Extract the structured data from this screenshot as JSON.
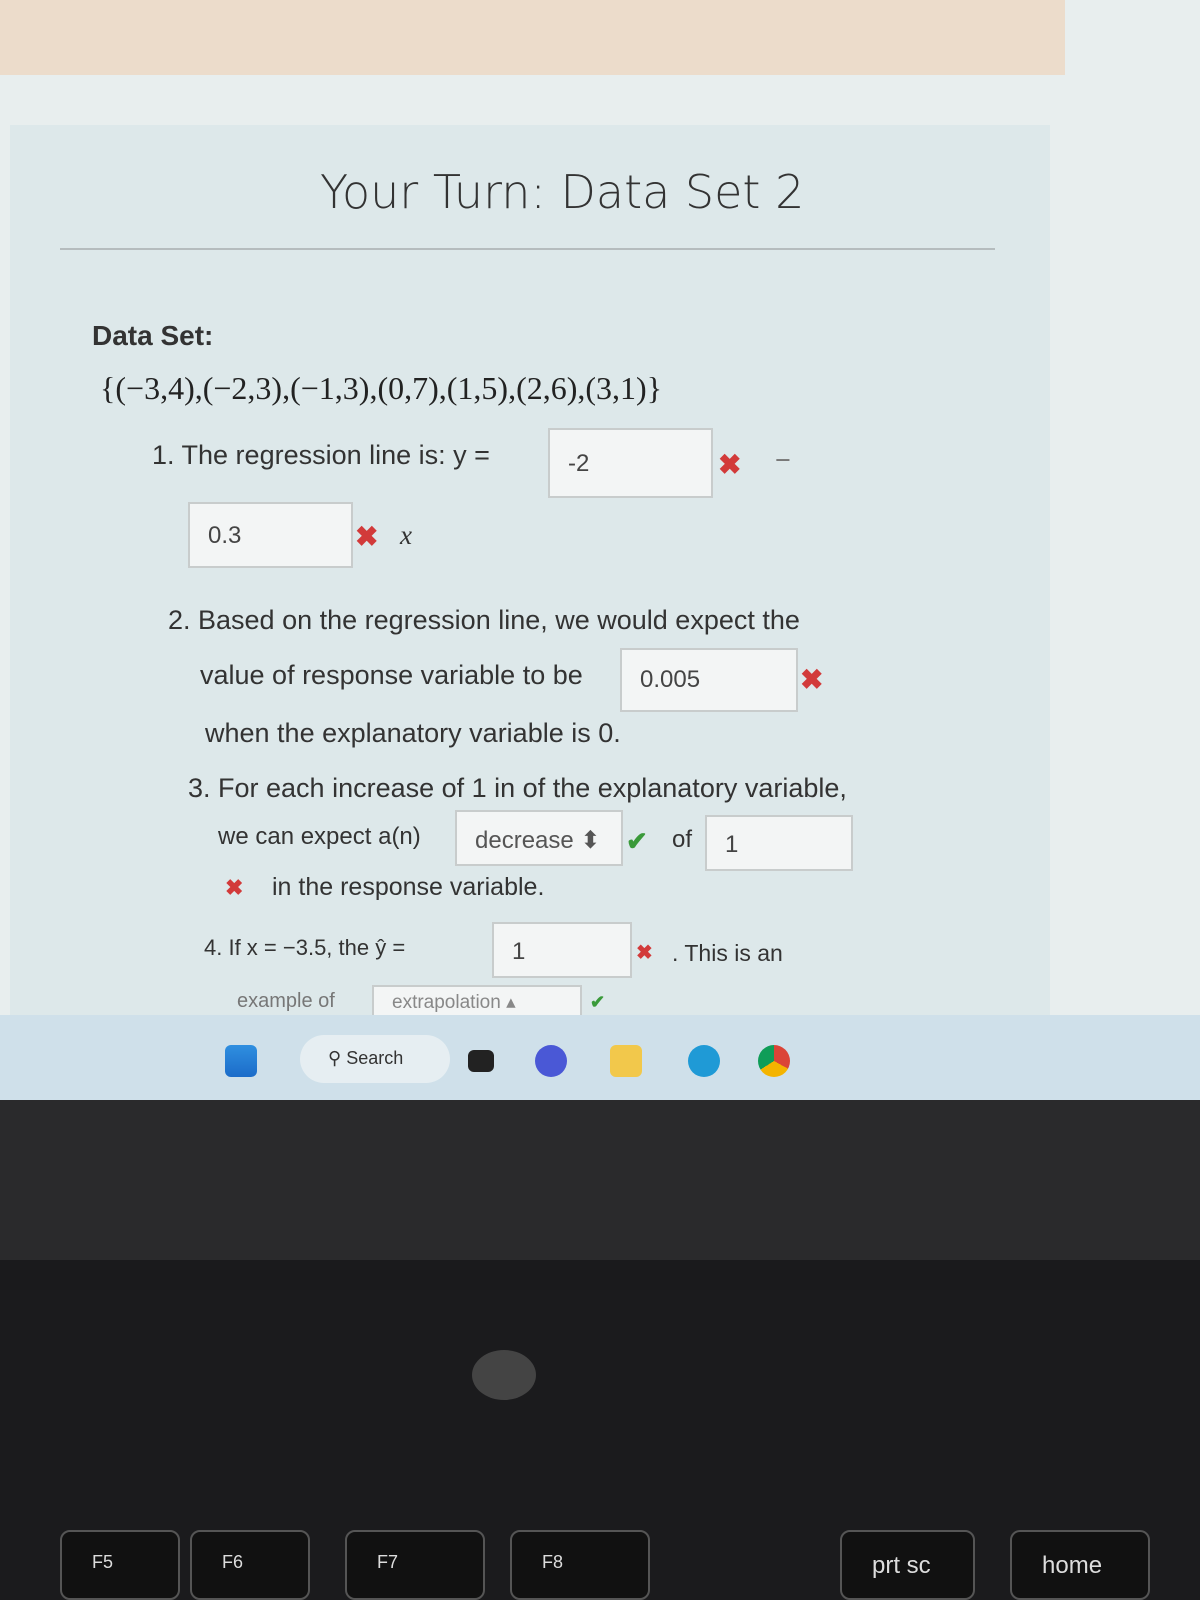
{
  "page": {
    "title": "Your Turn: Data Set 2",
    "data_set_label": "Data Set:",
    "data_set": "{(−3,4),(−2,3),(−1,3),(0,7),(1,5),(2,6),(3,1)}"
  },
  "q1": {
    "prefix": "1. The regression line is: y =",
    "intercept_value": "-2",
    "intercept_status": "incorrect",
    "minus": "−",
    "slope_value": "0.3",
    "slope_status": "incorrect",
    "x_var": "x"
  },
  "q2": {
    "line1": "2. Based on the regression line, we would expect the",
    "line2": "value of response variable to be",
    "value": "0.005",
    "status": "incorrect",
    "line3": "when the explanatory variable is 0."
  },
  "q3": {
    "line1": "3. For each increase of 1 in of the explanatory variable,",
    "line2": "we can expect a(n)",
    "select_value": "decrease",
    "select_status": "correct",
    "of": "of",
    "amount_value": "1",
    "amount_status": "incorrect",
    "line3": "in the response variable."
  },
  "q4": {
    "prefix": "4. If x = −3.5, the ŷ =",
    "value": "1",
    "status": "incorrect",
    "suffix": ". This is an",
    "line2": "example of",
    "select_value": "extrapolation",
    "select_status": "correct"
  },
  "taskbar": {
    "search_label": "Search",
    "icons": [
      "windows-start",
      "task-view",
      "teams",
      "file-explorer",
      "edge",
      "chrome"
    ]
  },
  "keyboard": {
    "keys": [
      "F5",
      "F6",
      "F7",
      "F8",
      "prt sc",
      "home"
    ]
  },
  "colors": {
    "incorrect": "#d23a3a",
    "correct": "#3a9a3a"
  }
}
